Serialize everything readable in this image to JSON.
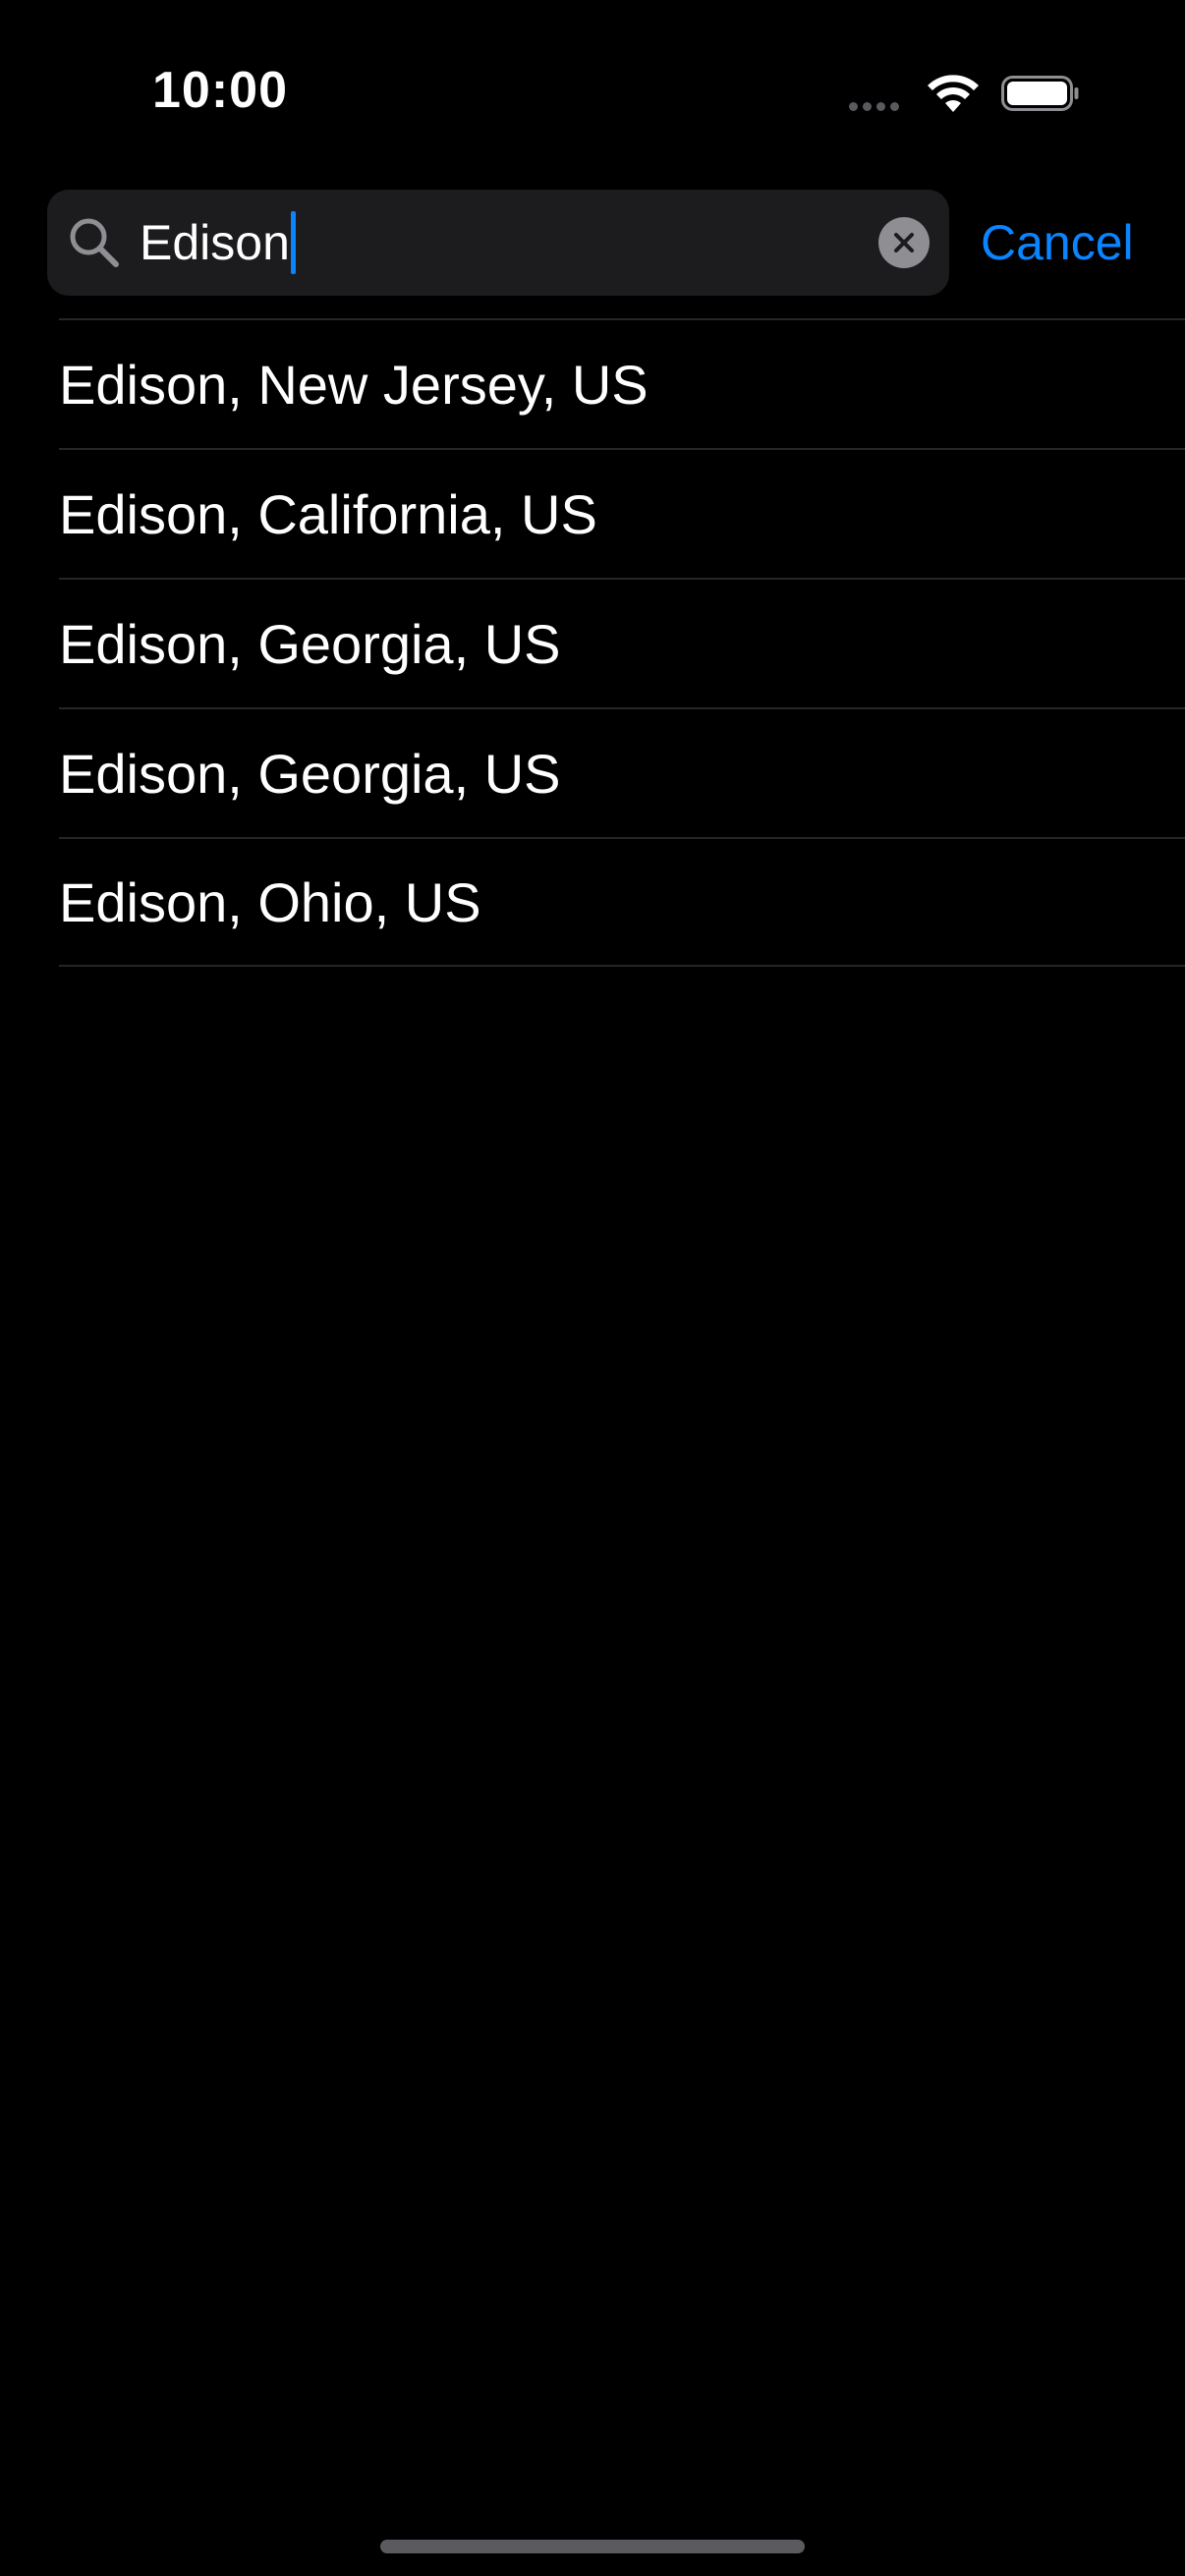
{
  "status_bar": {
    "time": "10:00",
    "wifi_icon": "wifi-icon",
    "battery_icon": "battery-icon",
    "signal_icon": "cellular-signal-icon"
  },
  "search": {
    "value": "Edison",
    "search_icon": "magnifying-glass-icon",
    "clear_icon": "clear-x-icon",
    "cancel_label": "Cancel"
  },
  "results": [
    {
      "label": "Edison, New Jersey, US"
    },
    {
      "label": "Edison, California, US"
    },
    {
      "label": "Edison, Georgia, US"
    },
    {
      "label": "Edison, Georgia, US"
    },
    {
      "label": "Edison, Ohio, US"
    }
  ],
  "colors": {
    "background": "#000000",
    "search_field": "#1c1c1e",
    "accent": "#0a84ff",
    "separator": "#262628",
    "text": "#ffffff"
  }
}
